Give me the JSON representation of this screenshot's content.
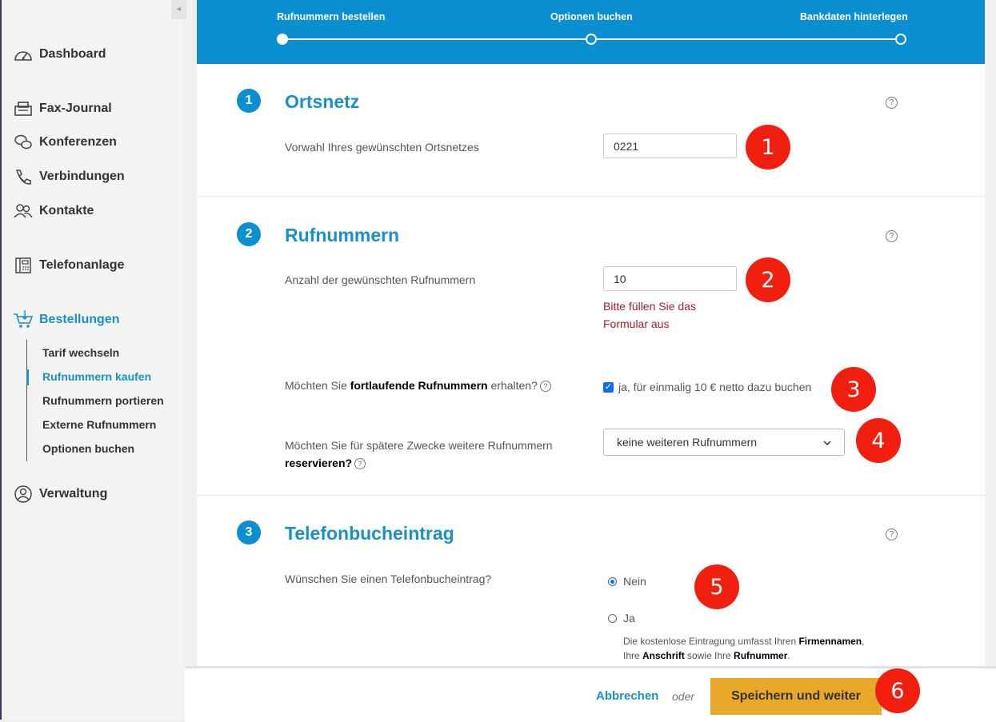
{
  "sidebar": {
    "collapse_icon": "◂",
    "items": [
      {
        "label": "Dashboard",
        "icon": "speedometer-icon"
      },
      {
        "label": "Fax-Journal",
        "icon": "fax-icon"
      },
      {
        "label": "Konferenzen",
        "icon": "chat-icon"
      },
      {
        "label": "Verbindungen",
        "icon": "phone-icon"
      },
      {
        "label": "Kontakte",
        "icon": "contacts-icon"
      },
      {
        "label": "Telefonanlage",
        "icon": "pbx-icon"
      },
      {
        "label": "Bestellungen",
        "icon": "cart-icon"
      },
      {
        "label": "Verwaltung",
        "icon": "user-circle-icon"
      }
    ],
    "subitems": [
      {
        "label": "Tarif wechseln"
      },
      {
        "label": "Rufnummern kaufen"
      },
      {
        "label": "Rufnummern portieren"
      },
      {
        "label": "Externe Rufnummern"
      },
      {
        "label": "Optionen buchen"
      }
    ],
    "active_item": "Bestellungen",
    "active_subitem": "Rufnummern kaufen"
  },
  "stepper": {
    "steps": [
      {
        "label": "Rufnummern bestellen"
      },
      {
        "label": "Optionen buchen"
      },
      {
        "label": "Bankdaten hinterlegen"
      }
    ]
  },
  "sections": {
    "ortsnetz": {
      "num": "1",
      "title": "Ortsnetz",
      "label": "Vorwahl Ihres gewünschten Ortsnetzes",
      "value": "0221"
    },
    "rufnummern": {
      "num": "2",
      "title": "Rufnummern",
      "count_label": "Anzahl der gewünschten Rufnummern",
      "count_value": "10",
      "error": "Bitte füllen Sie das Formular aus",
      "q_fortlaufend_pre": "Möchten Sie ",
      "q_fortlaufend_bold": "fortlaufende Rufnummern",
      "q_fortlaufend_post": " erhalten?",
      "checkbox_label": "ja, für einmalig 10 € netto dazu buchen",
      "q_reserve_pre": "Möchten Sie für spätere Zwecke weitere Rufnummern ",
      "q_reserve_bold": "reservieren?",
      "select_value": "keine weiteren Rufnummern"
    },
    "telefonbuch": {
      "num": "3",
      "title": "Telefonbucheintrag",
      "question": "Wünschen Sie einen Telefonbucheintrag?",
      "option_no": "Nein",
      "option_yes": "Ja",
      "note_1": "Die kostenlose Eintragung umfasst Ihren ",
      "note_firma": "Firmennamen",
      "note_2": ",",
      "note_3": "Ihre ",
      "note_anschrift": "Anschrift",
      "note_4": " sowie Ihre ",
      "note_rufnummer": "Rufnummer",
      "note_5": "."
    }
  },
  "help_glyph": "?",
  "badges": [
    "1",
    "2",
    "3",
    "4",
    "5",
    "6"
  ],
  "footer": {
    "cancel": "Abbrechen",
    "or": "oder",
    "save": "Speichern und weiter"
  },
  "colors": {
    "primary": "#0c8fd0",
    "link": "#1a90c8",
    "error": "#a71d2a",
    "badge": "#f01f0f",
    "save_button": "#e8a92b"
  }
}
